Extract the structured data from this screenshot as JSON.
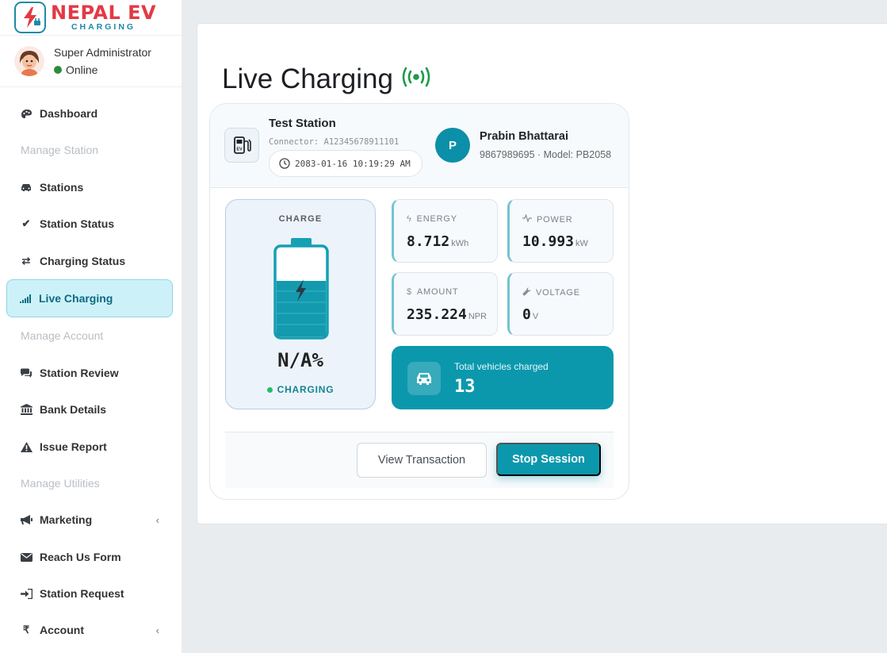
{
  "brand": {
    "title": "NEPAL EV",
    "subtitle": "CHARGING"
  },
  "user": {
    "name": "Super Administrator",
    "status": "Online"
  },
  "sidebar": {
    "items": [
      {
        "label": "Dashboard",
        "icon": "palette-icon"
      },
      {
        "header": "Manage Station"
      },
      {
        "label": "Stations",
        "icon": "car-icon"
      },
      {
        "label": "Station Status",
        "icon": "check-icon"
      },
      {
        "label": "Charging Status",
        "icon": "exchange-icon"
      },
      {
        "label": "Live Charging",
        "icon": "signal-icon",
        "active": true
      },
      {
        "header": "Manage Account"
      },
      {
        "label": "Station Review",
        "icon": "comments-icon"
      },
      {
        "label": "Bank Details",
        "icon": "bank-icon"
      },
      {
        "label": "Issue Report",
        "icon": "warning-icon"
      },
      {
        "header": "Manage Utilities"
      },
      {
        "label": "Marketing",
        "icon": "bullhorn-icon",
        "chevron": "‹"
      },
      {
        "label": "Reach Us Form",
        "icon": "envelope-icon"
      },
      {
        "label": "Station Request",
        "icon": "sign-in-icon"
      },
      {
        "label": "Account",
        "icon": "rupee-icon",
        "chevron": "‹"
      }
    ]
  },
  "page": {
    "title": "Live Charging"
  },
  "session": {
    "station_name": "Test Station",
    "connector": "Connector: A12345678911101",
    "datetime": "2083-01-16 10:19:29 AM",
    "person_initial": "P",
    "person_name": "Prabin Bhattarai",
    "person_meta": "9867989695 · Model: PB2058",
    "charge_label": "CHARGE",
    "charge_percent": "N/A%",
    "charge_state": "CHARGING",
    "metrics": [
      {
        "label": "ENERGY",
        "value": "8.712",
        "unit": "kWh",
        "icon": "bolt-icon"
      },
      {
        "label": "POWER",
        "value": "10.993",
        "unit": "kW",
        "icon": "pulse-icon"
      },
      {
        "label": "AMOUNT",
        "value": "235.224",
        "unit": "NPR",
        "icon": "dollar-icon"
      },
      {
        "label": "VOLTAGE",
        "value": "0",
        "unit": "V",
        "icon": "wrench-icon"
      }
    ],
    "vehicles_label": "Total vehicles charged",
    "vehicles_value": "13",
    "view_transaction": "View Transaction",
    "stop_session": "Stop Session"
  },
  "colors": {
    "accent": "#0b98ad",
    "brand_red": "#e23a45",
    "brand_teal": "#1e8aa6",
    "online": "#2e8b3a"
  }
}
